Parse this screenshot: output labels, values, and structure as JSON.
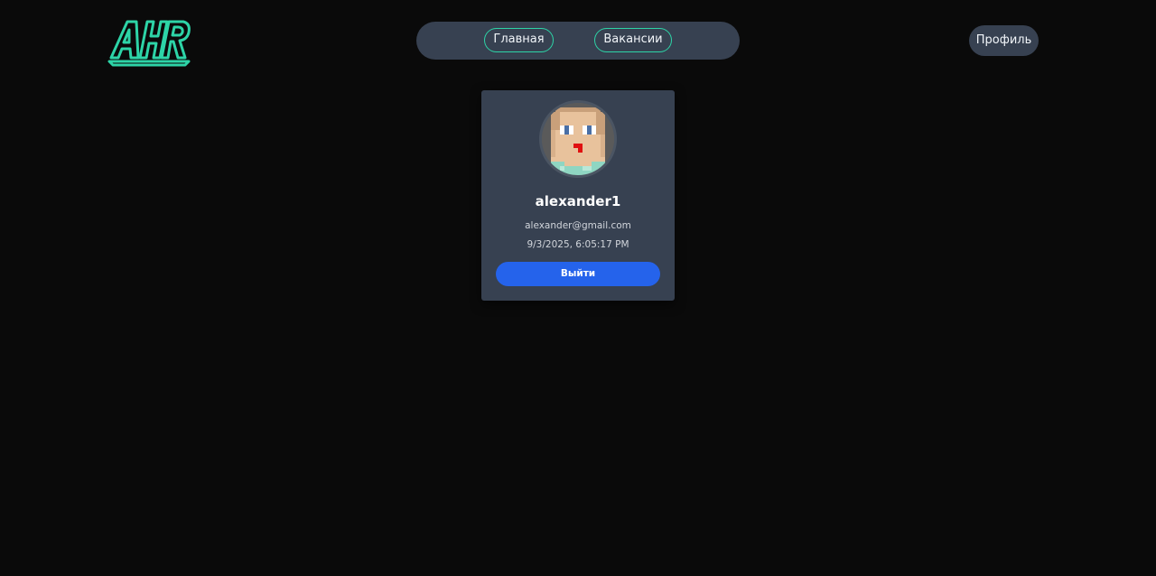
{
  "logo": {
    "text": "AHR",
    "color": "#2dd4a7"
  },
  "nav": {
    "main_label": "Главная",
    "jobs_label": "Вакансии"
  },
  "header": {
    "profile_label": "Профиль"
  },
  "profile": {
    "username": "alexander1",
    "email": "alexander@gmail.com",
    "created_at": "9/3/2025, 6:05:17 PM",
    "logout_label": "Выйти"
  },
  "colors": {
    "background": "#0a0a0a",
    "surface": "#374151",
    "accent": "#2dd4a7",
    "primary": "#2563eb"
  }
}
